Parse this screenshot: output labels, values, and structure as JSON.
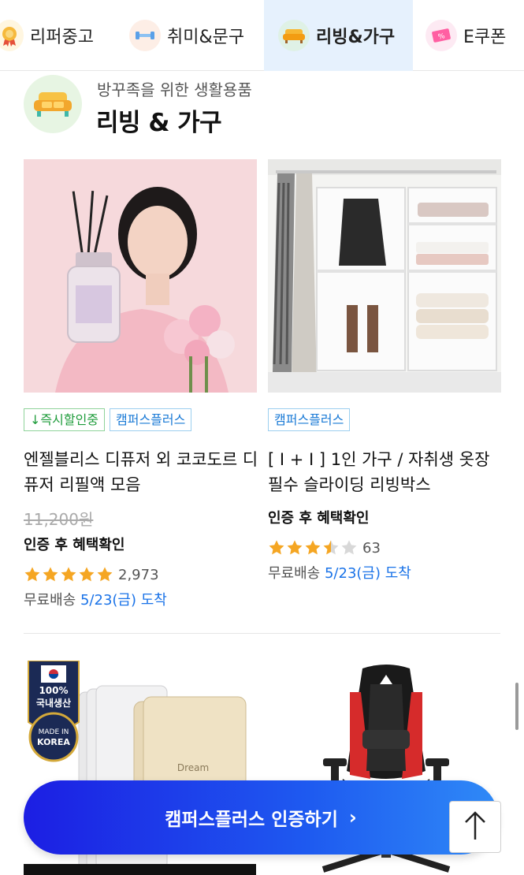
{
  "tabs": [
    {
      "label": "리퍼중고",
      "icon": "medal-icon"
    },
    {
      "label": "취미&문구",
      "icon": "dumbbell-icon"
    },
    {
      "label": "리빙&가구",
      "icon": "sofa-icon",
      "active": true
    },
    {
      "label": "E쿠폰",
      "icon": "coupon-icon"
    }
  ],
  "section": {
    "subtitle": "방꾸족을 위한 생활용품",
    "title": "리빙 & 가구",
    "icon": "sofa-icon"
  },
  "products": [
    {
      "badges": [
        "↓즉시할인중",
        "캠퍼스플러스"
      ],
      "name": "엔젤블리스 디퓨저 외 코코도르 디퓨저 리필액 모음",
      "old_price": "11,200원",
      "benefit": "인증 후 혜택확인",
      "rating": 5,
      "review_count": "2,973",
      "shipping_prefix": "무료배송",
      "shipping_date": "5/23(금) 도착"
    },
    {
      "badges": [
        "캠퍼스플러스"
      ],
      "name": "[ I + I ] 1인 가구 / 자취생 옷장 필수 슬라이딩 리빙박스",
      "benefit": "인증 후 혜택확인",
      "rating": 3.5,
      "review_count": "63",
      "shipping_prefix": "무료배송",
      "shipping_date": "5/23(금) 도착"
    }
  ],
  "lower_left_badge": {
    "line1": "100%",
    "line2": "국내생산",
    "line3": "MADE IN",
    "line4": "KOREA"
  },
  "cta": {
    "label": "캠퍼스플러스 인증하기",
    "chevron": "›"
  },
  "colors": {
    "cta_start": "#1c1ee3",
    "cta_end": "#2f8af7",
    "star": "#f5a623",
    "shipping_date": "#1a73e8",
    "active_tab_bg": "#e6f1fd"
  }
}
